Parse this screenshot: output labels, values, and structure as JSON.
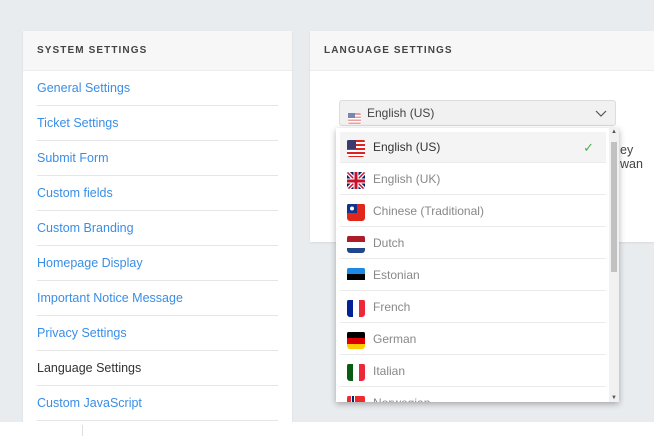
{
  "sidebar": {
    "title": "SYSTEM SETTINGS",
    "items": [
      {
        "label": "General Settings"
      },
      {
        "label": "Ticket Settings"
      },
      {
        "label": "Submit Form"
      },
      {
        "label": "Custom fields"
      },
      {
        "label": "Custom Branding"
      },
      {
        "label": "Homepage Display"
      },
      {
        "label": "Important Notice Message"
      },
      {
        "label": "Privacy Settings"
      },
      {
        "label": "Language Settings",
        "active": true
      },
      {
        "label": "Custom JavaScript"
      }
    ]
  },
  "main": {
    "title": "LANGUAGE SETTINGS",
    "select_value": "English (US)",
    "behind_text": "ey wan"
  },
  "dropdown": {
    "options": [
      {
        "label": "English (US)",
        "flag": "us",
        "selected": true
      },
      {
        "label": "English (UK)",
        "flag": "uk"
      },
      {
        "label": "Chinese (Traditional)",
        "flag": "tw"
      },
      {
        "label": "Dutch",
        "flag": "nl"
      },
      {
        "label": "Estonian",
        "flag": "ee"
      },
      {
        "label": "French",
        "flag": "fr"
      },
      {
        "label": "German",
        "flag": "de"
      },
      {
        "label": "Italian",
        "flag": "it"
      },
      {
        "label": "Norwegian",
        "flag": "no"
      }
    ]
  },
  "colors": {
    "link": "#3a8ee6",
    "check": "#4caf50"
  }
}
